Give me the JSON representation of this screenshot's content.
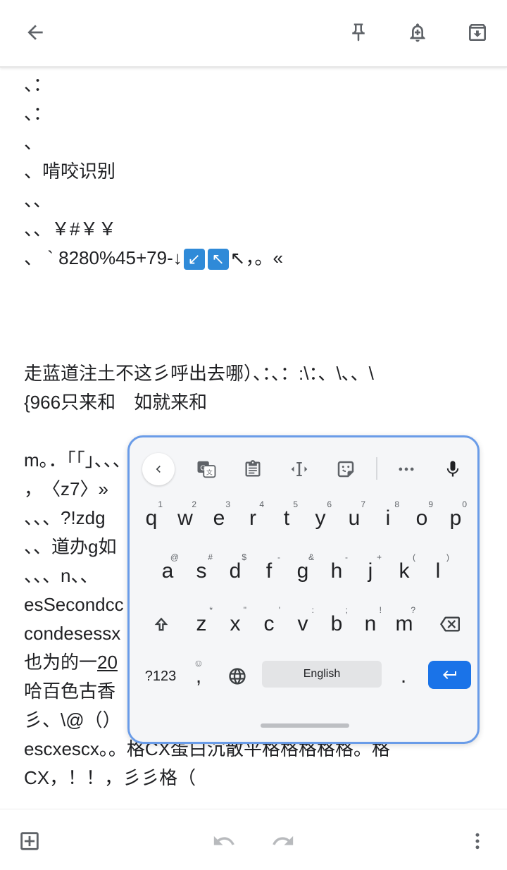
{
  "topbar": {
    "back_icon": "arrow-left",
    "pin_icon": "pin",
    "reminder_icon": "bell-plus",
    "archive_icon": "archive-down"
  },
  "note": {
    "lines": [
      "、：",
      "、：",
      "、",
      "、啃咬识别",
      "、、",
      "、、￥#￥￥",
      "、 ` 8280%45+79-↓"
    ],
    "line7_tail": "↖，。«",
    "line7_emojis": [
      "↙",
      "↖"
    ],
    "line_a": "走蓝道注土不这彡呼出去哪）、：、：:\\：、\\、、\\",
    "line_b": "{966只来和　如就来和",
    "line_c": "m。．「「」、、、",
    "line_d": "，　〈z7〉»",
    "line_e": "、、、?!zdg",
    "line_f": "、、道办g如",
    "line_g": "、、、n、、",
    "line_h": "esSecondcc",
    "line_i": "condesessx",
    "line_j_pre": "也为的一",
    "line_j_u": "20",
    "line_k": "哈百色古香",
    "line_l": "彡、\\@（）",
    "line_m": "escxescx。。格CX蛋白沉散平格格格格格。格",
    "line_n": "CX，！！，彡彡格（"
  },
  "keyboard": {
    "row1": [
      [
        "q",
        "1"
      ],
      [
        "w",
        "2"
      ],
      [
        "e",
        "3"
      ],
      [
        "r",
        "4"
      ],
      [
        "t",
        "5"
      ],
      [
        "y",
        "6"
      ],
      [
        "u",
        "7"
      ],
      [
        "i",
        "8"
      ],
      [
        "o",
        "9"
      ],
      [
        "p",
        "0"
      ]
    ],
    "row2": [
      [
        "a",
        "@"
      ],
      [
        "s",
        "#"
      ],
      [
        "d",
        "$"
      ],
      [
        "f",
        "-"
      ],
      [
        "g",
        "&"
      ],
      [
        "h",
        "-"
      ],
      [
        "j",
        "+"
      ],
      [
        "k",
        "("
      ],
      [
        "l",
        ")"
      ]
    ],
    "row3": [
      [
        "z",
        "*"
      ],
      [
        "x",
        "\""
      ],
      [
        "c",
        "'"
      ],
      [
        "v",
        ":"
      ],
      [
        "b",
        ";"
      ],
      [
        "n",
        "!"
      ],
      [
        "m",
        "?"
      ]
    ],
    "symbols_label": "?123",
    "space_label": "English",
    "period_label": ".",
    "comma_label": ","
  },
  "bottombar": {
    "add_icon": "add-box",
    "undo_icon": "undo",
    "redo_icon": "redo",
    "more_icon": "more-vert"
  },
  "colors": {
    "accent": "#1a73e8",
    "keyboard_border": "#6a9ce8"
  }
}
